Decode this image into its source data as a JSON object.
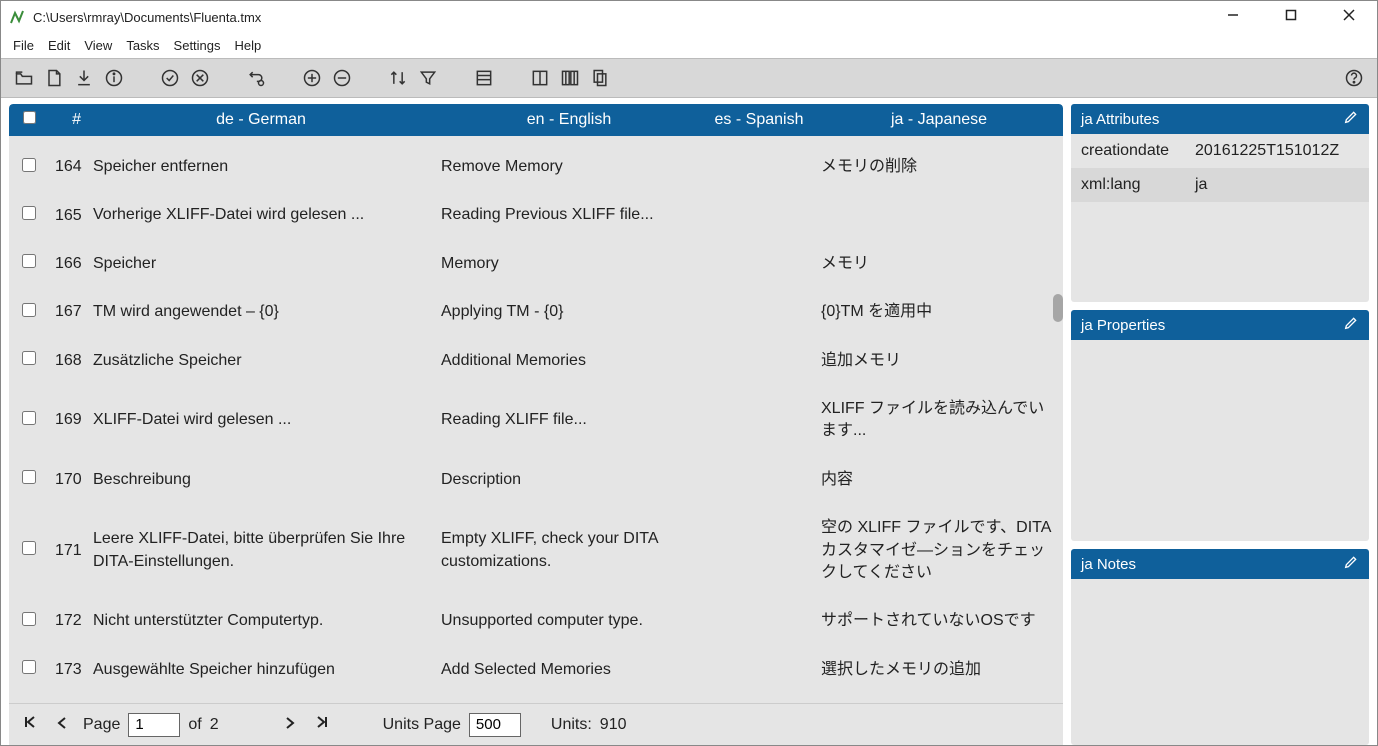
{
  "window": {
    "title": "C:\\Users\\rmray\\Documents\\Fluenta.tmx"
  },
  "menu": {
    "file": "File",
    "edit": "Edit",
    "view": "View",
    "tasks": "Tasks",
    "settings": "Settings",
    "help": "Help"
  },
  "columns": {
    "hash": "#",
    "de": "de - German",
    "en": "en - English",
    "es": "es - Spanish",
    "ja": "ja - Japanese"
  },
  "rows": [
    {
      "n": "164",
      "de": "Speicher entfernen",
      "en": "Remove Memory",
      "es": "",
      "ja": "メモリの削除"
    },
    {
      "n": "165",
      "de": "Vorherige XLIFF-Datei wird gelesen ...",
      "en": "Reading Previous XLIFF file...",
      "es": "",
      "ja": ""
    },
    {
      "n": "166",
      "de": "Speicher",
      "en": "Memory",
      "es": "",
      "ja": "メモリ"
    },
    {
      "n": "167",
      "de": "TM wird angewendet – {0}",
      "en": "Applying TM - {0}",
      "es": "",
      "ja": "{0}TM を適用中"
    },
    {
      "n": "168",
      "de": "Zusätzliche Speicher",
      "en": "Additional Memories",
      "es": "",
      "ja": "追加メモリ"
    },
    {
      "n": "169",
      "de": "XLIFF-Datei wird gelesen ...",
      "en": "Reading XLIFF file...",
      "es": "",
      "ja": "XLIFF ファイルを読み込んでいます..."
    },
    {
      "n": "170",
      "de": "Beschreibung",
      "en": "Description",
      "es": "",
      "ja": "内容"
    },
    {
      "n": "171",
      "de": "Leere XLIFF-Datei, bitte überprüfen Sie Ihre DITA-Einstellungen.",
      "en": "Empty XLIFF, check your DITA customizations.",
      "es": "",
      "ja": "空の XLIFF ファイルです、DITA カスタマイゼ―ションをチェックしてください"
    },
    {
      "n": "172",
      "de": "Nicht unterstützter Computertyp.",
      "en": "Unsupported computer type.",
      "es": "",
      "ja": "サポートされていないOSです"
    },
    {
      "n": "173",
      "de": "Ausgewählte Speicher hinzufügen",
      "en": "Add Selected Memories",
      "es": "",
      "ja": "選択したメモリの追加"
    }
  ],
  "sidebar": {
    "attributes": {
      "title": "ja  Attributes",
      "rows": [
        {
          "key": "creationdate",
          "val": "20161225T151012Z"
        },
        {
          "key": "xml:lang",
          "val": "ja"
        }
      ]
    },
    "properties": {
      "title": "ja  Properties"
    },
    "notes": {
      "title": "ja  Notes"
    }
  },
  "pagination": {
    "page_label": "Page",
    "page_value": "1",
    "of_label": "of",
    "total_pages": "2",
    "units_page_label": "Units Page",
    "units_page_value": "500",
    "units_label": "Units:",
    "units_total": "910"
  }
}
